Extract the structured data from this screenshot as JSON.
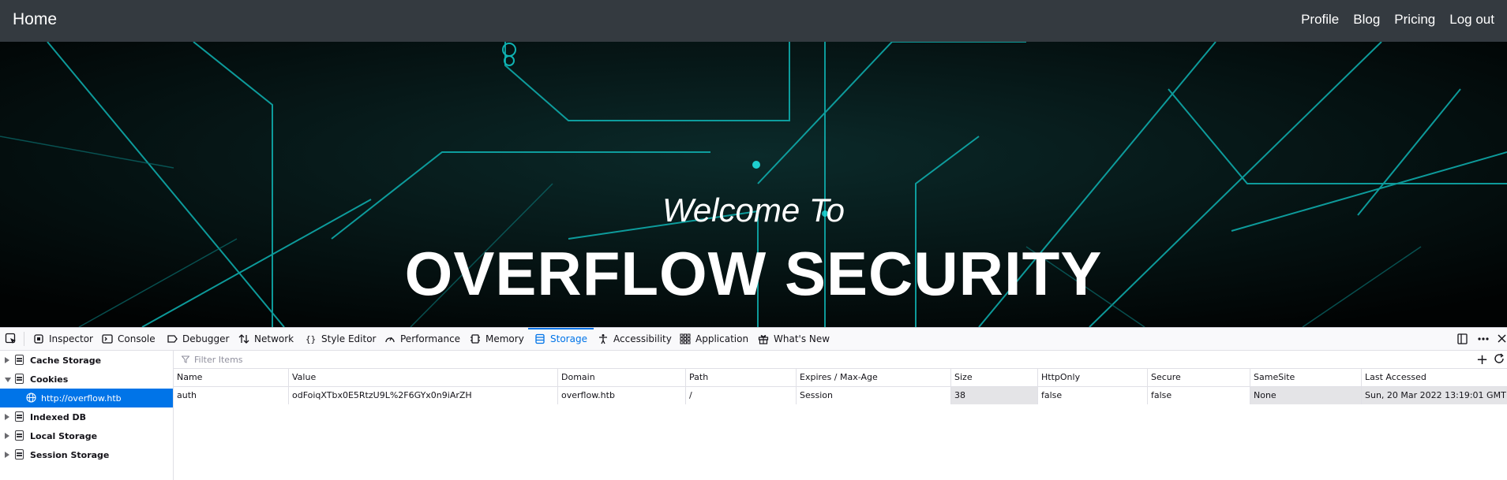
{
  "navbar": {
    "brand": "Home",
    "links": [
      "Profile",
      "Blog",
      "Pricing",
      "Log out"
    ]
  },
  "hero": {
    "subtitle": "Welcome To",
    "title": "OVERFLOW SECURITY"
  },
  "devtools": {
    "tabs": [
      {
        "label": "Inspector",
        "icon": "inspector-icon"
      },
      {
        "label": "Console",
        "icon": "console-icon"
      },
      {
        "label": "Debugger",
        "icon": "debugger-icon"
      },
      {
        "label": "Network",
        "icon": "network-icon"
      },
      {
        "label": "Style Editor",
        "icon": "style-editor-icon"
      },
      {
        "label": "Performance",
        "icon": "performance-icon"
      },
      {
        "label": "Memory",
        "icon": "memory-icon"
      },
      {
        "label": "Storage",
        "icon": "storage-icon",
        "active": true
      },
      {
        "label": "Accessibility",
        "icon": "accessibility-icon"
      },
      {
        "label": "Application",
        "icon": "application-icon"
      },
      {
        "label": "What's New",
        "icon": "gift-icon"
      }
    ],
    "active_color": "#0074e8"
  },
  "storage_tree": {
    "items": [
      {
        "label": "Cache Storage",
        "expanded": false
      },
      {
        "label": "Cookies",
        "expanded": true
      },
      {
        "label": "http://overflow.htb",
        "selected": true
      },
      {
        "label": "Indexed DB",
        "expanded": false
      },
      {
        "label": "Local Storage",
        "expanded": false
      },
      {
        "label": "Session Storage",
        "expanded": false
      }
    ]
  },
  "filter": {
    "placeholder": "Filter Items"
  },
  "cookie_table": {
    "columns": [
      "Name",
      "Value",
      "Domain",
      "Path",
      "Expires / Max-Age",
      "Size",
      "HttpOnly",
      "Secure",
      "SameSite",
      "Last Accessed"
    ],
    "rows": [
      [
        "auth",
        "odFoiqXTbx0E5RtzU9L%2F6GYx0n9iArZH",
        "overflow.htb",
        "/",
        "Session",
        "38",
        "false",
        "false",
        "None",
        "Sun, 20 Mar 2022 13:19:01 GMT"
      ]
    ]
  }
}
